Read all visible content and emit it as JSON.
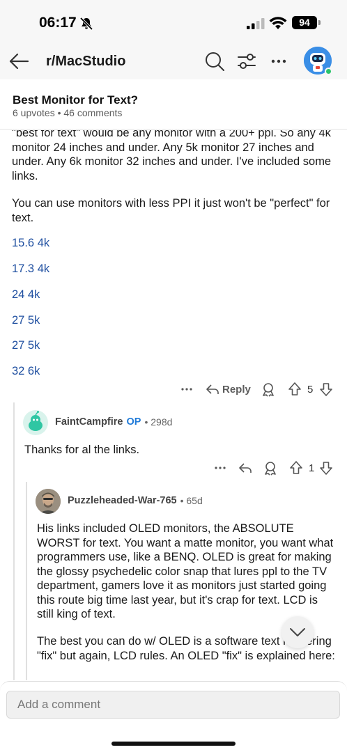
{
  "status_bar": {
    "time": "06:17",
    "battery": "94"
  },
  "header": {
    "subreddit": "r/MacStudio"
  },
  "post": {
    "title": "Best Monitor for Text?",
    "meta": "6 upvotes • 46 comments"
  },
  "comment1": {
    "paragraphs": [
      "\"best for text\" would be any monitor with a 200+ ppi. So any 4k monitor 24 inches and under. Any 5k monitor 27 inches and under. Any 6k monitor 32 inches and under. I've included some links.",
      "You can use monitors with less PPI it just won't be \"perfect\" for text."
    ],
    "links": [
      "15.6 4k",
      "17.3 4k",
      "24 4k",
      "27 5k",
      "27 5k",
      "32 6k"
    ],
    "reply_label": "Reply",
    "votes": "5"
  },
  "comment2": {
    "username": "FaintCampfire",
    "op_badge": "OP",
    "age": "• 298d",
    "body": "Thanks for al the links.",
    "votes": "1"
  },
  "comment3": {
    "username": "Puzzleheaded-War-765",
    "age": "• 65d",
    "paragraphs": [
      "His links included OLED monitors, the ABSOLUTE WORST for text. You want a matte monitor, you want what programmers use, like a BENQ. OLED is great for making the glossy psychedelic color snap that lures ppl to the TV department, gamers love it as monitors just started going this route big time last year, but it's crap for text. LCD is still king of text.",
      "The best you can do w/ OLED is a software text rendering \"fix\" but again, LCD rules. An OLED \"fix\" is explained here:"
    ]
  },
  "comment_box": {
    "placeholder": "Add a comment"
  },
  "colors": {
    "link": "#1f4fa0",
    "op_badge": "#1f7ad8",
    "online": "#2bc46b"
  }
}
